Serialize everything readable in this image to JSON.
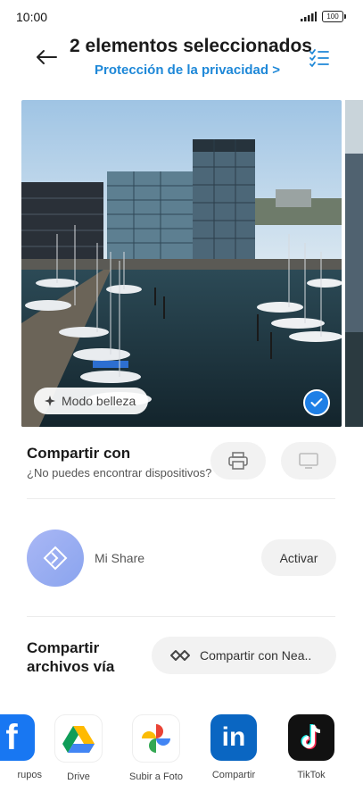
{
  "status_bar": {
    "time": "10:00",
    "battery": "100"
  },
  "header": {
    "title": "2 elementos seleccionados",
    "subtitle": "Protección de la privacidad",
    "subtitle_chevron": ">"
  },
  "photo": {
    "beauty_label": "Modo belleza"
  },
  "share_with": {
    "title": "Compartir con",
    "subtitle": "¿No puedes encontrar dispositivos?"
  },
  "mi_share": {
    "label": "Mi Share",
    "button": "Activar"
  },
  "share_files": {
    "title": "Compartir archivos vía",
    "nearby_button": "Compartir con Nea.."
  },
  "apps": [
    {
      "label": "rupos",
      "icon": "facebook-icon"
    },
    {
      "label": "Drive",
      "icon": "google-drive-icon"
    },
    {
      "label": "Subir a Foto",
      "icon": "google-photos-icon"
    },
    {
      "label": "Compartir ",
      "icon": "linkedin-icon"
    },
    {
      "label": "TikTok",
      "icon": "tiktok-icon"
    }
  ],
  "colors": {
    "accent": "#1e88d8",
    "check": "#1e7fe6"
  }
}
